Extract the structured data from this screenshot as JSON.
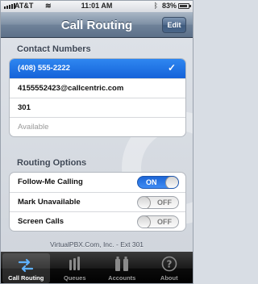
{
  "status_bar": {
    "carrier": "AT&T",
    "time": "11:01 AM",
    "battery": "83%"
  },
  "nav": {
    "title": "Call Routing",
    "edit_label": "Edit"
  },
  "contact_numbers": {
    "header": "Contact Numbers",
    "items": [
      {
        "label": "(408) 555-2222",
        "selected": true
      },
      {
        "label": "4155552423@callcentric.com",
        "selected": false
      },
      {
        "label": "301",
        "selected": false
      },
      {
        "label": "Available",
        "placeholder": true
      }
    ]
  },
  "routing_options": {
    "header": "Routing Options",
    "items": [
      {
        "label": "Follow-Me Calling",
        "toggle": "ON",
        "state": true
      },
      {
        "label": "Mark Unavailable",
        "toggle": "OFF",
        "state": false
      },
      {
        "label": "Screen Calls",
        "toggle": "OFF",
        "state": false
      }
    ]
  },
  "footer": "VirtualPBX.Com, Inc. - Ext 301",
  "tabs": [
    {
      "label": "Call Routing",
      "icon": "arrows-icon",
      "active": true
    },
    {
      "label": "Queues",
      "icon": "queues-icon",
      "active": false
    },
    {
      "label": "Accounts",
      "icon": "accounts-icon",
      "active": false
    },
    {
      "label": "About",
      "icon": "question-icon",
      "active": false
    }
  ],
  "colors": {
    "accent": "#1462d9",
    "nav": "#6f8299",
    "tab_bar": "#0b0b0b"
  }
}
